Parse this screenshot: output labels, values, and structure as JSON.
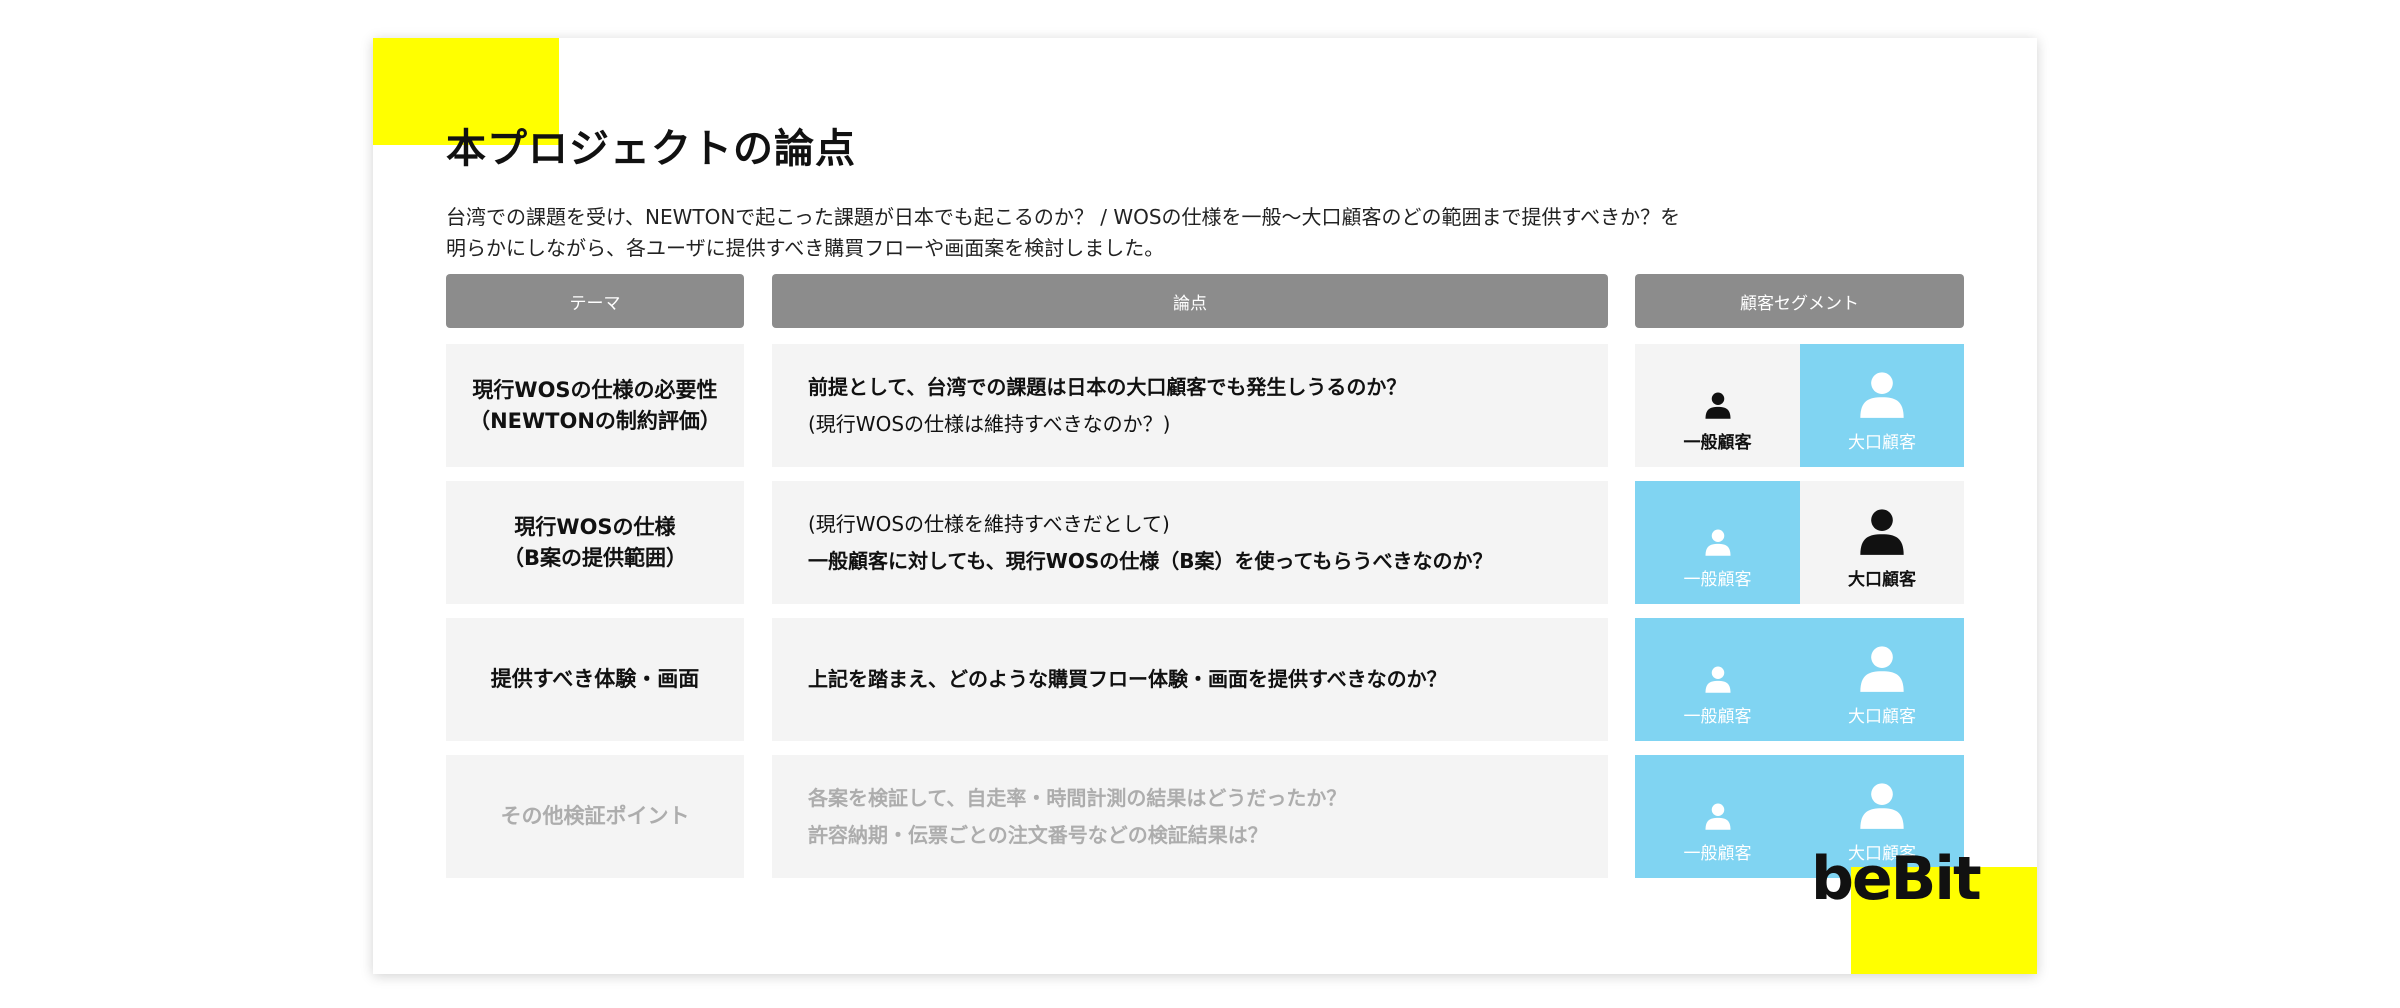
{
  "slide": {
    "title": "本プロジェクトの論点",
    "description_lines": [
      "台湾での課題を受け、NEWTONで起こった課題が日本でも起こるのか？ / WOSの仕様を一般〜大口顧客のどの範囲まで提供すべきか？を",
      "明らかにしながら、各ユーザに提供すべき購買フローや画面案を検討しました。"
    ],
    "headers": {
      "theme": "テーマ",
      "issue": "論点",
      "segment": "顧客セグメント"
    },
    "rows": [
      {
        "theme_lines": [
          "現行WOSの仕様の必要性",
          "（NEWTONの制約評価）"
        ],
        "issue_lines": [
          {
            "text": "前提として、台湾での課題は日本の大口顧客でも発生しうるのか？",
            "bold": true
          },
          {
            "text": "(現行WOSの仕様は維持すべきなのか？)",
            "bold": false
          }
        ],
        "general": {
          "label": "一般顧客",
          "highlighted": false
        },
        "large": {
          "label": "大口顧客",
          "highlighted": true
        },
        "muted": false
      },
      {
        "theme_lines": [
          "現行WOSの仕様",
          "（B案の提供範囲）"
        ],
        "issue_lines": [
          {
            "text": "(現行WOSの仕様を維持すべきだとして)",
            "bold": false
          },
          {
            "text": "一般顧客に対しても、現行WOSの仕様（B案）を使ってもらうべきなのか？",
            "bold": true
          }
        ],
        "general": {
          "label": "一般顧客",
          "highlighted": true
        },
        "large": {
          "label": "大口顧客",
          "highlighted": false
        },
        "muted": false
      },
      {
        "theme_lines": [
          "提供すべき体験・画面"
        ],
        "issue_lines": [
          {
            "text": "上記を踏まえ、どのような購買フロー体験・画面を提供すべきなのか？",
            "bold": true
          }
        ],
        "general": {
          "label": "一般顧客",
          "highlighted": true
        },
        "large": {
          "label": "大口顧客",
          "highlighted": true
        },
        "muted": false
      },
      {
        "theme_lines": [
          "その他検証ポイント"
        ],
        "issue_lines": [
          {
            "text": "各案を検証して、自走率・時間計測の結果はどうだったか？",
            "bold": true
          },
          {
            "text": "許容納期・伝票ごとの注文番号などの検証結果は？",
            "bold": true
          }
        ],
        "general": {
          "label": "一般顧客",
          "highlighted": true
        },
        "large": {
          "label": "大口顧客",
          "highlighted": true
        },
        "muted": true
      }
    ],
    "logo": "beBit",
    "colors": {
      "accent_yellow": "#ffff00",
      "segment_highlight": "#80d4f2",
      "header_gray": "#8c8c8c",
      "cell_gray": "#f4f4f4"
    },
    "icons": {
      "general_customer": "person-icon-small",
      "large_customer": "person-icon-large"
    }
  }
}
